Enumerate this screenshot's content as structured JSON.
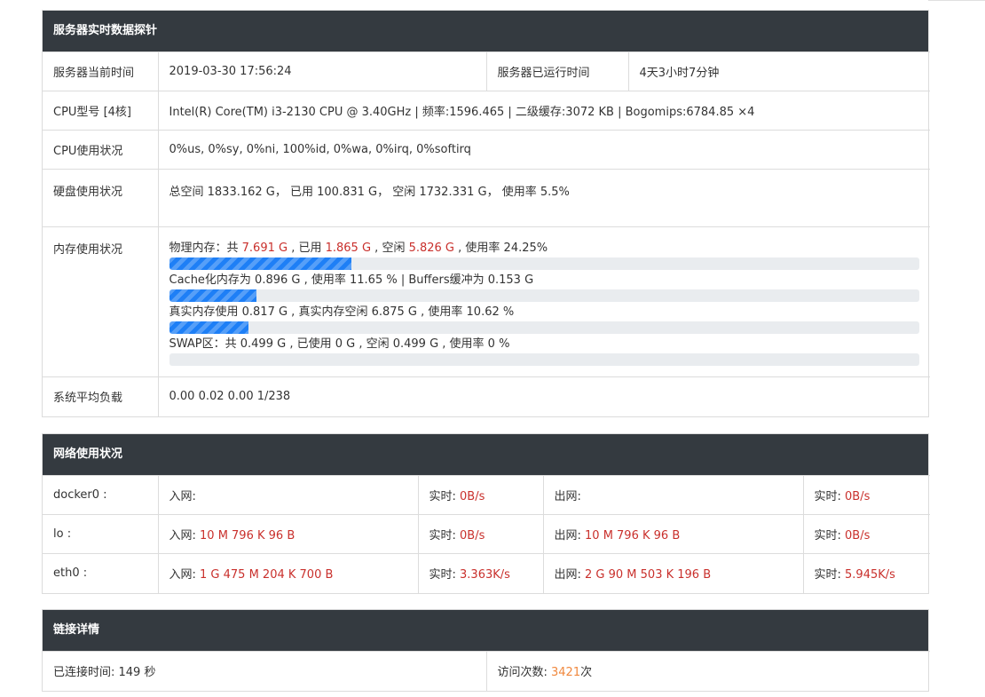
{
  "server": {
    "title": "服务器实时数据探针",
    "time_label": "服务器当前时间",
    "time_value": "2019-03-30 17:56:24",
    "uptime_label": "服务器已运行时间",
    "uptime_value": "4天3小时7分钟",
    "cpu_model_label": "CPU型号 [4核]",
    "cpu_model_value": "Intel(R) Core(TM) i3-2130 CPU @ 3.40GHz | 频率:1596.465 | 二级缓存:3072 KB | Bogomips:6784.85 ×4",
    "cpu_usage_label": "CPU使用状况",
    "cpu_usage_value": "0%us, 0%sy, 0%ni, 100%id, 0%wa, 0%irq, 0%softirq",
    "disk_label": "硬盘使用状况",
    "disk_value": "总空间 1833.162 G， 已用 100.831 G， 空闲 1732.331 G， 使用率 5.5%",
    "memory_label": "内存使用状况",
    "memory": {
      "phys_prefix": "物理内存：共 ",
      "phys_total": "7.691 G",
      "phys_mid1": " , 已用 ",
      "phys_used": "1.865 G",
      "phys_mid2": " , 空闲 ",
      "phys_free": "5.826 G",
      "phys_suffix": " , 使用率 24.25%",
      "phys_percent": 24.25,
      "cache_line": "Cache化内存为 0.896 G , 使用率 11.65 % | Buffers缓冲为 0.153 G",
      "cache_percent": 11.65,
      "real_line": "真实内存使用 0.817 G , 真实内存空闲 6.875 G , 使用率 10.62 %",
      "real_percent": 10.62,
      "swap_line": "SWAP区：共 0.499 G , 已使用 0 G , 空闲 0.499 G , 使用率 0 %",
      "swap_percent": 0
    },
    "load_label": "系统平均负载",
    "load_value": "0.00 0.02 0.00 1/238"
  },
  "network": {
    "title": "网络使用状况",
    "in_label": "入网: ",
    "out_label": "出网: ",
    "rt_label": "实时: ",
    "rows": [
      {
        "iface": "docker0 :",
        "in": "",
        "in_rt": "0B/s",
        "out": "",
        "out_rt": "0B/s"
      },
      {
        "iface": "lo :",
        "in": "10 M 796 K 96 B",
        "in_rt": "0B/s",
        "out": "10 M 796 K 96 B",
        "out_rt": "0B/s"
      },
      {
        "iface": "eth0 :",
        "in": "1 G 475 M 204 K 700 B",
        "in_rt": "3.363K/s",
        "out": "2 G 90 M 503 K 196 B",
        "out_rt": "5.945K/s"
      }
    ]
  },
  "connection": {
    "title": "链接详情",
    "time_text": "已连接时间: 149 秒",
    "visits_prefix": "访问次数: ",
    "visits_count": "3421",
    "visits_suffix": "次"
  },
  "colors": {
    "header_bg": "#343a40",
    "highlight_red": "#c9302c",
    "highlight_orange": "#f0883e",
    "bar_fill": "#1e7ff6"
  }
}
